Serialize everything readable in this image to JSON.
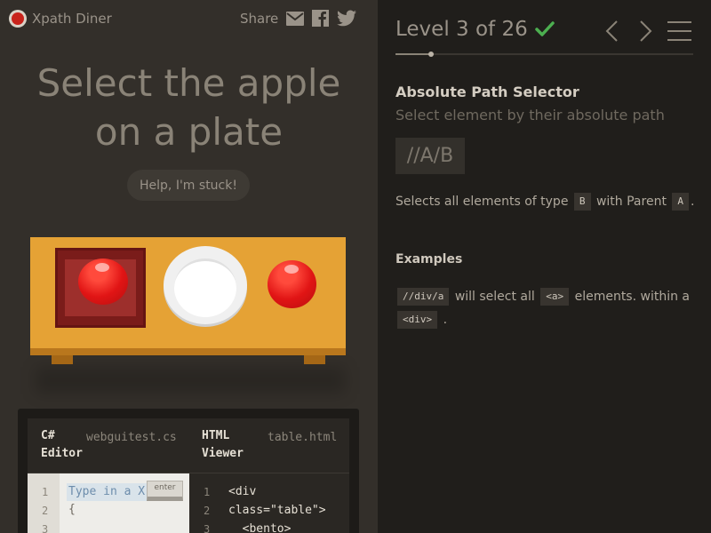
{
  "brand": {
    "name": "Xpath Diner"
  },
  "share": {
    "label": "Share",
    "icons": [
      "mail-icon",
      "facebook-icon",
      "twitter-icon"
    ]
  },
  "instruction": {
    "line1": "Select the apple",
    "line2": "on a plate"
  },
  "help": {
    "label": "Help, I'm stuck!"
  },
  "editor": {
    "csharp_tab": "C#",
    "csharp_tab2": "Editor",
    "csharp_file": "webguitest.cs",
    "html_tab": "HTML",
    "html_tab2": "Viewer",
    "html_file": "table.html",
    "csharp_lines": [
      "1",
      "2",
      "3"
    ],
    "csharp_input": "Type in a X",
    "csharp_brace": "{",
    "enter_label": "enter",
    "html_lines": [
      "1",
      "2",
      "3"
    ],
    "html_code": [
      "<div",
      "class=\"table\">",
      "  <bento>"
    ]
  },
  "level": {
    "text": "Level 3 of 26",
    "completed": true,
    "progress": 0.12
  },
  "selector": {
    "title": "Absolute Path Selector",
    "subtitle": "Select element by their absolute path",
    "syntax": "//A/B",
    "desc_pre": "Selects all elements of type",
    "desc_chip1": "B",
    "desc_mid": "with Parent",
    "desc_chip2": "A",
    "desc_end": "."
  },
  "examples": {
    "heading": "Examples",
    "chip1": "//div/a",
    "text1": "will select all",
    "chip2": "<a>",
    "text2": "elements. within a",
    "chip3": "<div>",
    "text3": "."
  },
  "colors": {
    "accent_check": "#4caf50",
    "apple": "#e11515",
    "table": "#e5a235"
  }
}
